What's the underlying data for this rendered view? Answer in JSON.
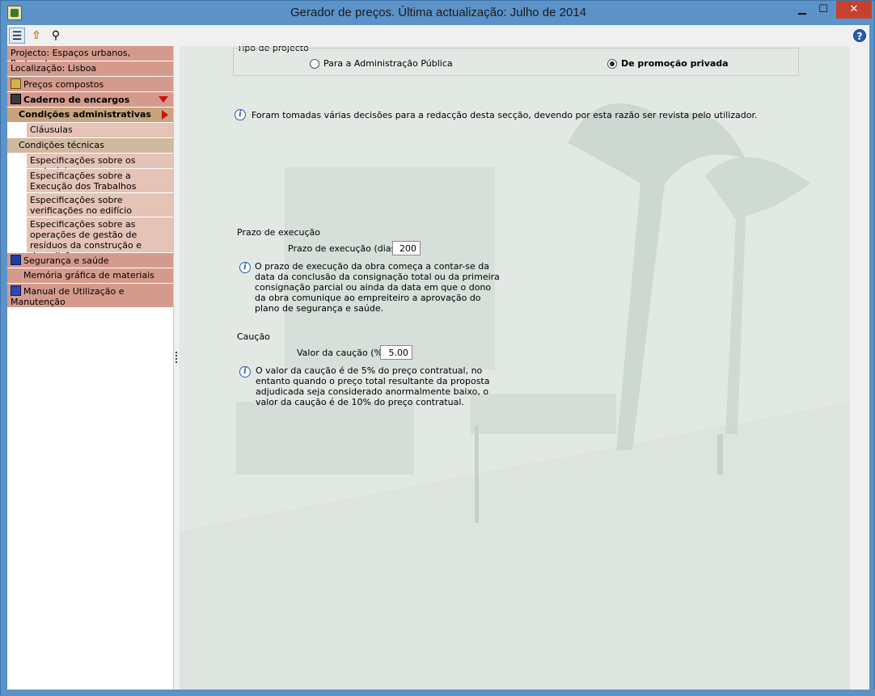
{
  "window": {
    "title": "Gerador de preços. Última actualização: Julho de 2014",
    "min": "▁",
    "max": "☐",
    "close": "✕"
  },
  "toolbar": {
    "list_icon": "list-icon",
    "up_icon": "arrow-up-icon",
    "find_icon": "binoculars-icon",
    "help_label": "?"
  },
  "sidebar": {
    "projecto": "Projecto: Espaços urbanos, Portugal",
    "localizacao": "Localização: Lisboa",
    "precos": "Preços compostos",
    "caderno": "Caderno de encargos",
    "cond_admin": "Condições administrativas",
    "clausulas": "Cláusulas",
    "cond_tec": "Condições técnicas",
    "esp_mat": "Especificações sobre os materiais",
    "esp_exec": "Especificações sobre a Execução dos Trabalhos",
    "esp_verif": "Especificações sobre verificações no edifício finalizado",
    "esp_resid": "Especificações sobre as operações de gestão de resíduos da construção e demolição",
    "seguranca": "Segurança e saúde",
    "memoria": "Memória gráfica de materiais",
    "manual": "Manual de Utilização e Manutenção"
  },
  "main": {
    "tipo_label": "Tipo de projecto",
    "radio_admin": "Para a Administração Pública",
    "radio_privada": "De promoção privada",
    "info_decisoes": "Foram tomadas várias decisões para a redacção desta secção, devendo por esta razão ser revista pelo utilizador.",
    "prazo_label": "Prazo de execução",
    "prazo_field_label": "Prazo de execução (dias):",
    "prazo_value": "200",
    "prazo_info_1": "O prazo de execução da obra começa a contar-se da",
    "prazo_info_2": "data da conclusão da consignação total ou da primeira",
    "prazo_info_3": "consignação parcial ou ainda da data em que o dono",
    "prazo_info_4": "da obra comunique ao empreiteiro a aprovação do",
    "prazo_info_5": "plano de segurança e saúde.",
    "caucao_label": "Caução",
    "caucao_field_label": "Valor da caução (%):",
    "caucao_value": "5.00",
    "caucao_info_1": "O valor da caução é de 5% do preço contratual, no",
    "caucao_info_2": "entanto quando o preço total resultante da proposta",
    "caucao_info_3": "adjudicada seja considerado anormalmente baixo, o",
    "caucao_info_4": "valor da caução é de 10% do preço contratual."
  }
}
